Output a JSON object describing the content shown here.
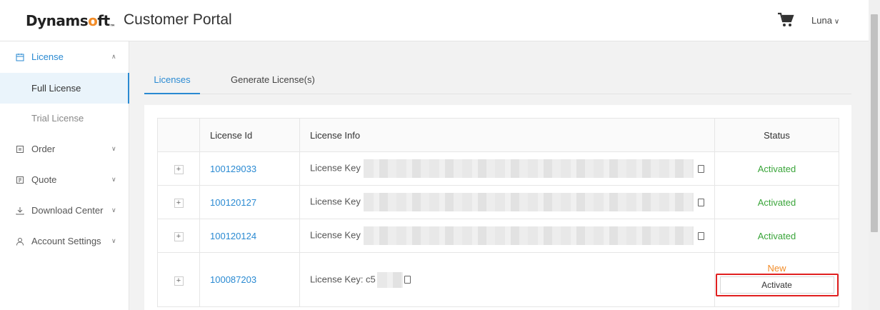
{
  "header": {
    "logo_text_pre": "Dynams",
    "logo_text_o": "o",
    "logo_text_post": "ft",
    "logo_tm": "™",
    "title": "Customer Portal",
    "user_name": "Luna",
    "cart_icon": "shopping-cart"
  },
  "sidebar": {
    "items": [
      {
        "label": "License",
        "icon": "license-icon",
        "expanded": true
      },
      {
        "label": "Full License"
      },
      {
        "label": "Trial License"
      },
      {
        "label": "Order",
        "icon": "order-icon"
      },
      {
        "label": "Quote",
        "icon": "quote-icon"
      },
      {
        "label": "Download Center",
        "icon": "download-icon"
      },
      {
        "label": "Account Settings",
        "icon": "user-icon"
      }
    ]
  },
  "tabs": [
    {
      "label": "Licenses",
      "active": true
    },
    {
      "label": "Generate License(s)"
    }
  ],
  "table": {
    "headers": [
      "",
      "License Id",
      "License Info",
      "Status"
    ],
    "rows": [
      {
        "id": "100129033",
        "key_label": "License Key",
        "status": "Activated"
      },
      {
        "id": "100120127",
        "key_label": "License Key",
        "status": "Activated"
      },
      {
        "id": "100120124",
        "key_label": "License Key",
        "status": "Activated"
      },
      {
        "id": "100087203",
        "key_label": "License Key: c5",
        "status": "New",
        "action": "Activate"
      }
    ]
  },
  "colors": {
    "accent": "#2a8ad2",
    "activated": "#3aa53a",
    "new": "#f28c28",
    "highlight": "#e02020"
  }
}
